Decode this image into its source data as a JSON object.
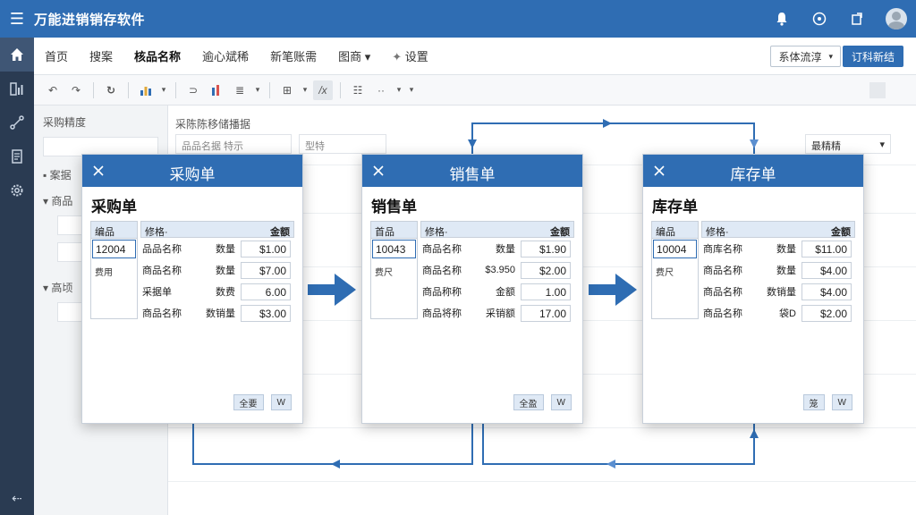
{
  "app": {
    "title": "万能进销销存软件"
  },
  "menu": {
    "items": [
      "首页",
      "搜案",
      "核品名称",
      "逾心斌稀",
      "新笔账需",
      "图商",
      "设置"
    ],
    "menu5_dropdown": "▾",
    "right_select": "系体流淳",
    "primary_button": "订科新结"
  },
  "sidebar": {
    "title": "采购精度",
    "row1": "案据",
    "row2": "商品",
    "row3": "高顷"
  },
  "workspace": {
    "label": "采陈陈移储播据",
    "select1": "品品名据 特示",
    "select2": "型特",
    "select_right": "最精精"
  },
  "dialogs": [
    {
      "header": "采购单",
      "subtitle": "采购单",
      "left_header": "编品",
      "left_id": "12004",
      "left_note": "费用",
      "col_left": "修格·",
      "col_right": "金额",
      "rows": [
        {
          "name": "品品名称",
          "qty": "数量",
          "amount": "$1.00"
        },
        {
          "name": "商品名称",
          "qty": "数量",
          "amount": "$7.00"
        },
        {
          "name": "采据单",
          "qty": "数费",
          "amount": "6.00"
        },
        {
          "name": "商品名称",
          "qty": "数销量",
          "amount": "$3.00"
        }
      ],
      "btn1": "全要",
      "btn2": "W"
    },
    {
      "header": "销售单",
      "subtitle": "销售单",
      "left_header": "首品",
      "left_id": "10043",
      "left_note": "费尺",
      "col_left": "修格·",
      "col_right": "金额",
      "rows": [
        {
          "name": "商品名称",
          "qty": "数量",
          "amount": "$1.90"
        },
        {
          "name": "商品名称",
          "qty": "$3.950",
          "amount": "$2.00"
        },
        {
          "name": "商品称称",
          "qty": "金额",
          "amount": "1.00"
        },
        {
          "name": "商品将称",
          "qty": "采销额",
          "amount": "17.00"
        }
      ],
      "btn1": "全盈",
      "btn2": "W"
    },
    {
      "header": "库存单",
      "subtitle": "库存单",
      "left_header": "编品",
      "left_id": "10004",
      "left_note": "费尺",
      "col_left": "修格·",
      "col_right": "金额",
      "rows": [
        {
          "name": "商库名称",
          "qty": "数量",
          "amount": "$11.00"
        },
        {
          "name": "商品名称",
          "qty": "数量",
          "amount": "$4.00"
        },
        {
          "name": "商品名称",
          "qty": "数销量",
          "amount": "$4.00"
        },
        {
          "name": "商品名称",
          "qty": "袋D",
          "amount": "$2.00"
        }
      ],
      "btn1": "笼",
      "btn2": "W"
    }
  ],
  "colors": {
    "primary": "#2f6db3",
    "nav": "#2a3b52",
    "header_cell": "#dfe9f5"
  }
}
